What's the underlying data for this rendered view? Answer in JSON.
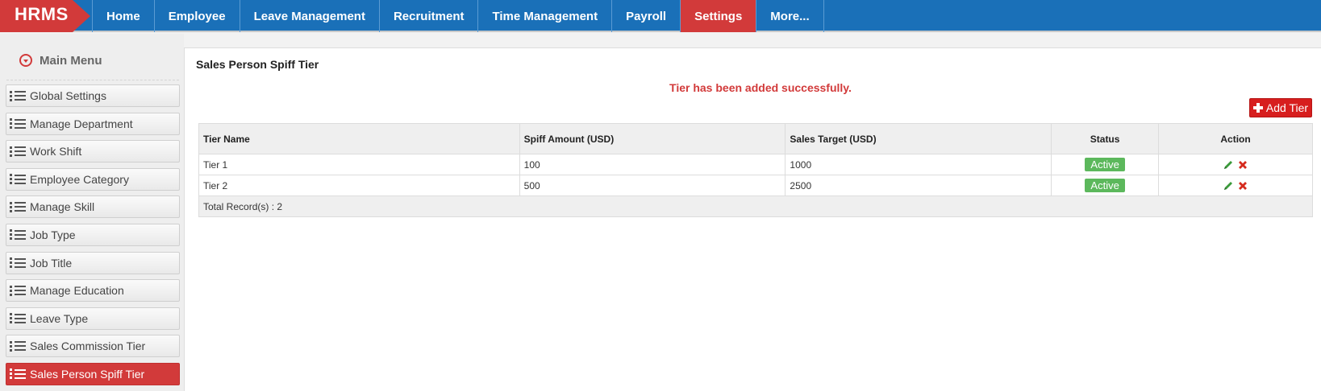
{
  "app": {
    "logo": "HRMS"
  },
  "nav": [
    {
      "label": "Home",
      "name": "nav-home"
    },
    {
      "label": "Employee",
      "name": "nav-employee"
    },
    {
      "label": "Leave Management",
      "name": "nav-leave-management"
    },
    {
      "label": "Recruitment",
      "name": "nav-recruitment"
    },
    {
      "label": "Time Management",
      "name": "nav-time-management"
    },
    {
      "label": "Payroll",
      "name": "nav-payroll"
    },
    {
      "label": "Settings",
      "name": "nav-settings",
      "active": true
    },
    {
      "label": "More...",
      "name": "nav-more"
    }
  ],
  "sidebar": {
    "header": "Main Menu",
    "items": [
      {
        "label": "Global Settings"
      },
      {
        "label": "Manage Department"
      },
      {
        "label": "Work Shift"
      },
      {
        "label": "Employee Category"
      },
      {
        "label": "Manage Skill"
      },
      {
        "label": "Job Type"
      },
      {
        "label": "Job Title"
      },
      {
        "label": "Manage Education"
      },
      {
        "label": "Leave Type"
      },
      {
        "label": "Sales Commission Tier"
      },
      {
        "label": "Sales Person Spiff Tier",
        "active": true
      }
    ]
  },
  "main": {
    "title": "Sales Person Spiff Tier",
    "flash_message": "Tier has been added successfully.",
    "add_button_label": "Add Tier",
    "table": {
      "columns": [
        "Tier Name",
        "Spiff Amount (USD)",
        "Sales Target (USD)",
        "Status",
        "Action"
      ],
      "rows": [
        {
          "tier_name": "Tier 1",
          "spiff_amount": "100",
          "sales_target": "1000",
          "status": "Active"
        },
        {
          "tier_name": "Tier 2",
          "spiff_amount": "500",
          "sales_target": "2500",
          "status": "Active"
        }
      ],
      "footer": "Total Record(s) :  2"
    }
  },
  "colors": {
    "nav_bg": "#1a70b8",
    "accent_red": "#d23a3a",
    "status_green": "#5cb85c",
    "add_button": "#d71e1e"
  }
}
